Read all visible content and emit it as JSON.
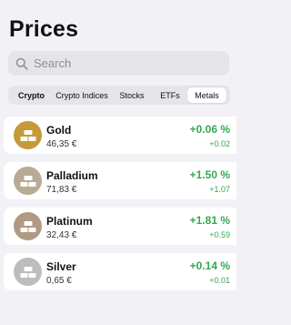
{
  "header": {
    "title": "Prices"
  },
  "search": {
    "placeholder": "Search"
  },
  "tabs": [
    {
      "label": "Crypto",
      "bold": true,
      "selected": false
    },
    {
      "label": "Crypto Indices",
      "bold": false,
      "selected": false
    },
    {
      "label": "Stocks",
      "bold": false,
      "selected": false
    },
    {
      "label": "ETFs",
      "bold": false,
      "selected": false
    },
    {
      "label": "Metals",
      "bold": false,
      "selected": true
    }
  ],
  "metals": [
    {
      "name": "Gold",
      "price": "46,35 €",
      "change_pct": "+0.06 %",
      "change_abs": "+0.02",
      "icon": "gold-bars-icon",
      "color": "#c49a3a"
    },
    {
      "name": "Palladium",
      "price": "71,83 €",
      "change_pct": "+1.50 %",
      "change_abs": "+1.07",
      "icon": "palladium-bars-icon",
      "color": "#b9aa95"
    },
    {
      "name": "Platinum",
      "price": "32,43 €",
      "change_pct": "+1.81 %",
      "change_abs": "+0.59",
      "icon": "platinum-bars-icon",
      "color": "#b09a84"
    },
    {
      "name": "Silver",
      "price": "0,65 €",
      "change_pct": "+0.14 %",
      "change_abs": "+0.01",
      "icon": "silver-bars-icon",
      "color": "#bdbdbd"
    }
  ],
  "colors": {
    "positive": "#34a853",
    "background": "#f2f2f6"
  }
}
